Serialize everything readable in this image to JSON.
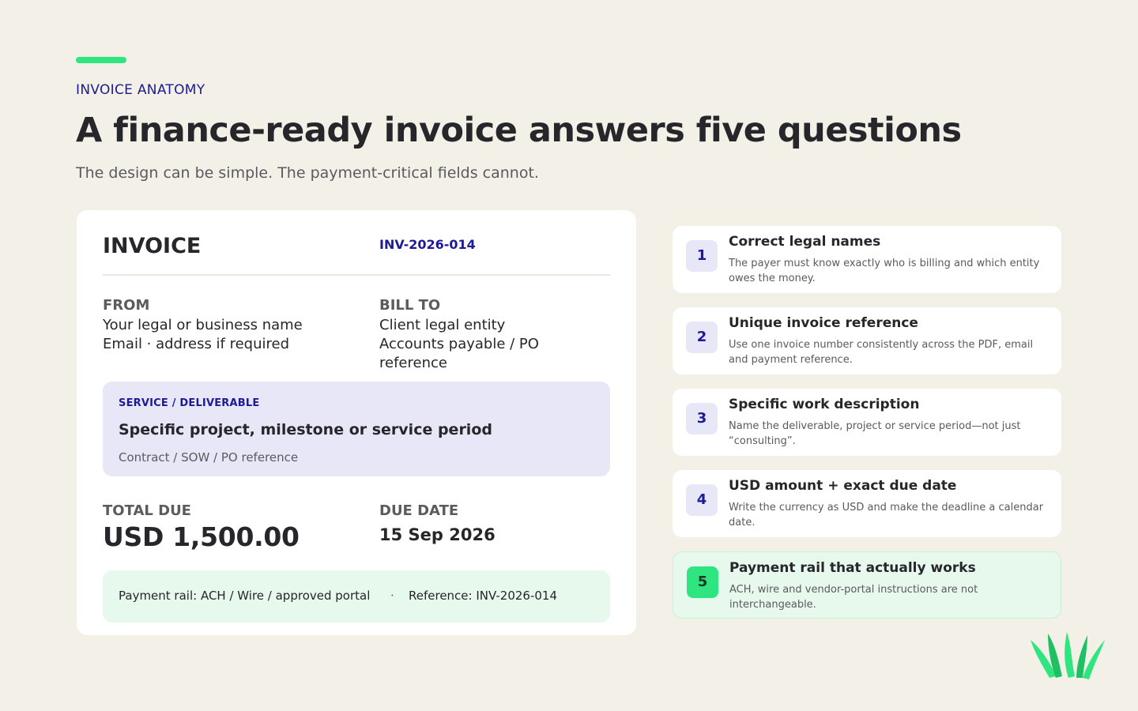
{
  "header": {
    "eyebrow": "INVOICE ANATOMY",
    "title": "A finance-ready invoice answers five questions",
    "subtitle": "The design can be simple. The payment-critical fields cannot."
  },
  "invoice": {
    "title": "INVOICE",
    "number": "INV-2026-014",
    "from": {
      "label": "FROM",
      "line1": "Your legal or business name",
      "line2": "Email · address if required"
    },
    "bill_to": {
      "label": "BILL TO",
      "line1": "Client legal entity",
      "line2": "Accounts payable / PO reference"
    },
    "service": {
      "label": "SERVICE / DELIVERABLE",
      "title": "Specific project, milestone or service period",
      "reference": "Contract / SOW / PO reference"
    },
    "total": {
      "label": "TOTAL DUE",
      "value": "USD 1,500.00"
    },
    "due": {
      "label": "DUE DATE",
      "value": "15 Sep 2026"
    },
    "payment": {
      "rail": "Payment rail: ACH / Wire / approved portal",
      "separator": "·",
      "reference": "Reference: INV-2026-014"
    }
  },
  "questions": [
    {
      "number": "1",
      "title": "Correct legal names",
      "description": "The payer must know exactly who is billing and which entity owes the money."
    },
    {
      "number": "2",
      "title": "Unique invoice reference",
      "description": "Use one invoice number consistently across the PDF, email and payment reference."
    },
    {
      "number": "3",
      "title": "Specific work description",
      "description": "Name the deliverable, project or service period—not just “consulting”."
    },
    {
      "number": "4",
      "title": "USD amount + exact due date",
      "description": "Write the currency as USD and make the deadline a calendar date."
    },
    {
      "number": "5",
      "title": "Payment rail that actually works",
      "description": "ACH, wire and vendor-portal instructions are not interchangeable."
    }
  ],
  "colors": {
    "accent_green": "#2ee57f",
    "brand_navy": "#1d1a96",
    "background": "#f3f0e8"
  },
  "icons": {
    "logo": "leaf-sprout-logo"
  }
}
